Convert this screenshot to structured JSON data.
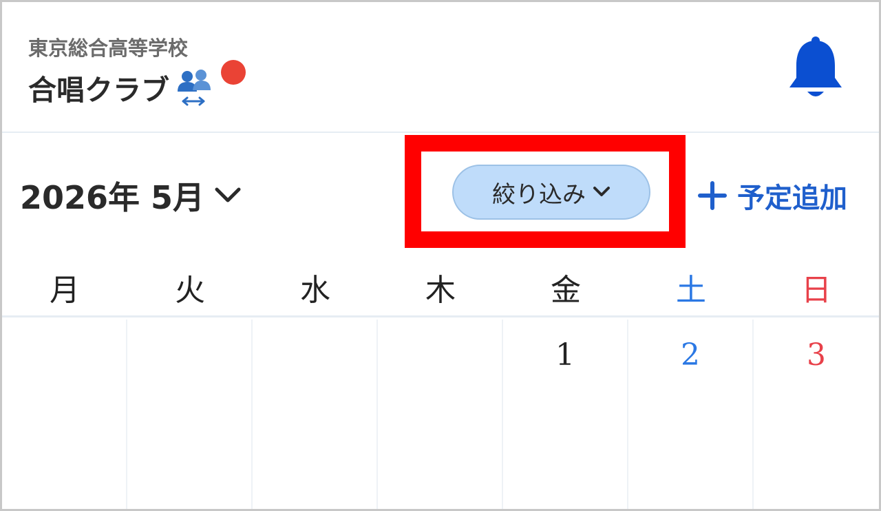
{
  "header": {
    "school_name": "東京総合高等学校",
    "club_name": "合唱クラブ",
    "members_icon": "people-swap-icon",
    "notification_icon": "bell-icon"
  },
  "toolbar": {
    "month_label": "2026年 5月",
    "filter_label": "絞り込み",
    "add_label": "予定追加"
  },
  "calendar": {
    "weekdays": [
      "月",
      "火",
      "水",
      "木",
      "金",
      "土",
      "日"
    ],
    "week1": [
      "",
      "",
      "",
      "",
      "1",
      "2",
      "3"
    ]
  },
  "colors": {
    "accent": "#1f5fcc",
    "saturday": "#2b78e4",
    "sunday": "#e8414a",
    "filter_bg": "#bfdcfa",
    "highlight": "#ff0000",
    "badge": "#ea4335"
  }
}
